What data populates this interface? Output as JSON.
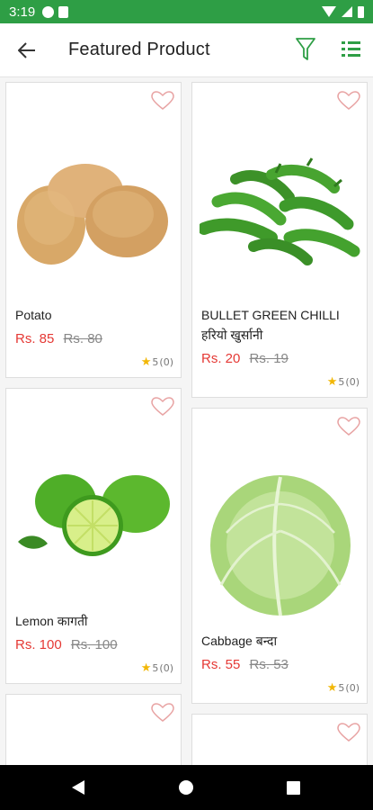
{
  "status_bar": {
    "time": "3:19"
  },
  "header": {
    "title": "Featured Product"
  },
  "products": [
    {
      "name": "Potato",
      "price": "Rs. 85",
      "old_price": "Rs. 80",
      "rating": "5",
      "reviews": "(0)"
    },
    {
      "name": "BULLET GREEN CHILLI हरियो खुर्सानी",
      "price": "Rs. 20",
      "old_price": "Rs. 19",
      "rating": "5",
      "reviews": "(0)"
    },
    {
      "name": "Lemon कागती",
      "price": "Rs. 100",
      "old_price": "Rs. 100",
      "rating": "5",
      "reviews": "(0)"
    },
    {
      "name": "Cabbage बन्दा",
      "price": "Rs. 55",
      "old_price": "Rs. 53",
      "rating": "5",
      "reviews": "(0)"
    }
  ],
  "colors": {
    "accent": "#2e9e45",
    "price": "#e53935",
    "star": "#f2b705",
    "heart": "#e8a3a3"
  }
}
